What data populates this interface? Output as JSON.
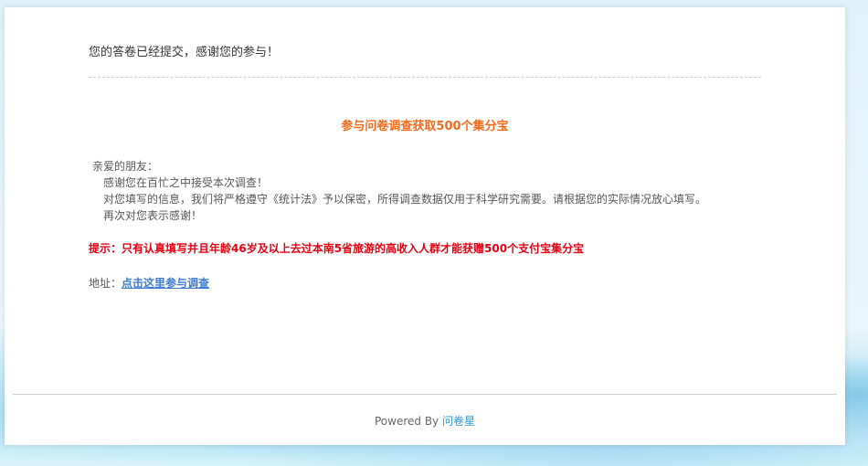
{
  "submission": {
    "message": "您的答卷已经提交，感谢您的参与！"
  },
  "promo": {
    "title": "参与问卷调查获取500个集分宝"
  },
  "letter": {
    "greeting": "亲爱的朋友：",
    "lines": [
      "感谢您在百忙之中接受本次调查！",
      "对您填写的信息，我们将严格遵守《统计法》予以保密，所得调查数据仅用于科学研究需要。请根据您的实际情况放心填写。",
      "再次对您表示感谢！"
    ]
  },
  "tip": {
    "text": "提示：只有认真填写并且年龄46岁及以上去过本南5省旅游的高收入人群才能获赠500个支付宝集分宝"
  },
  "address": {
    "label": "地址：",
    "link_text": "点击这里参与调查"
  },
  "footer": {
    "powered_by": "Powered By",
    "brand_link": "问卷星"
  },
  "colors": {
    "promo_title": "#f26b1d",
    "tip_text": "#e60012",
    "link": "#3b7bd0",
    "brand_link": "#2a9bd6"
  }
}
